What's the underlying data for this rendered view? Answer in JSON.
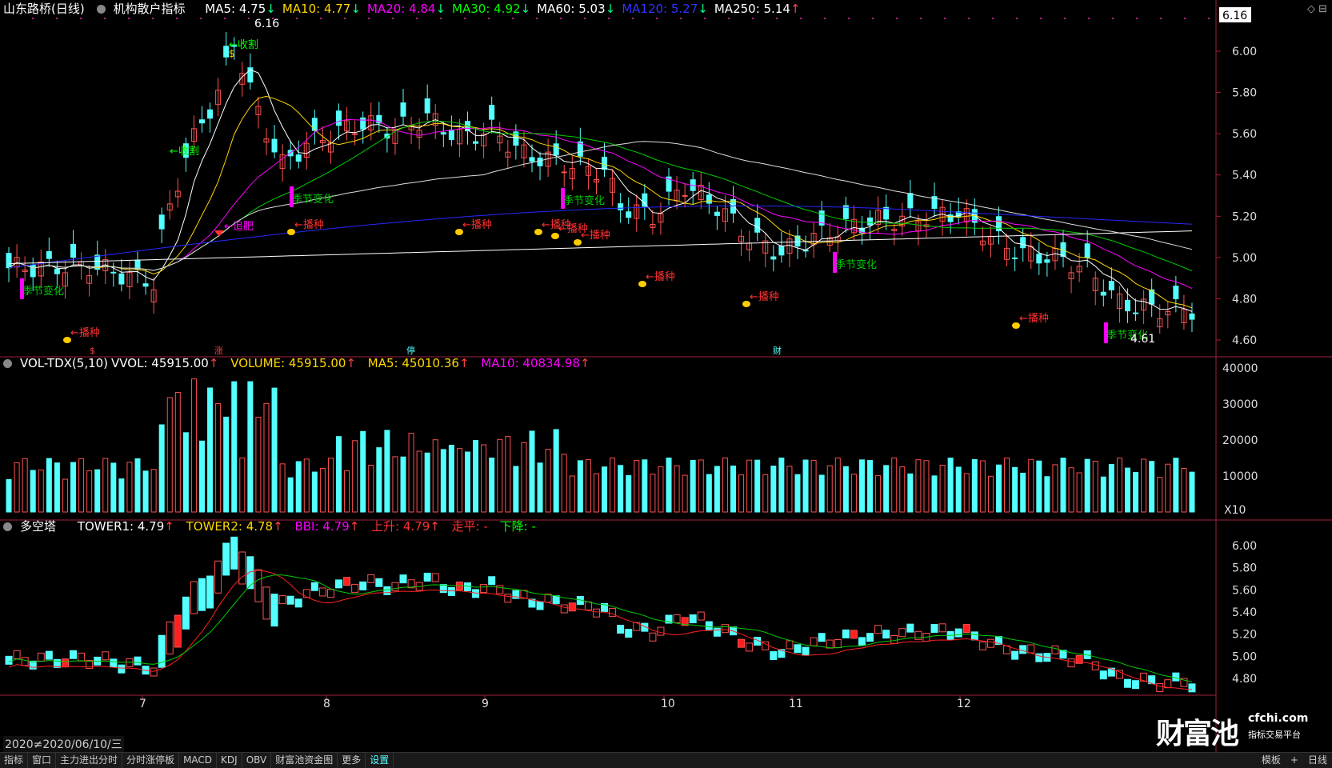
{
  "main": {
    "stock_name": "山东路桥(日线)",
    "indicator": "机构散户指标",
    "ma": [
      {
        "label": "MA5: 4.75",
        "color": "#ffffff"
      },
      {
        "label": "MA10: 4.77",
        "color": "#ffd700"
      },
      {
        "label": "MA20: 4.84",
        "color": "#ff00ff"
      },
      {
        "label": "MA30: 4.92",
        "color": "#00ff00"
      },
      {
        "label": "MA60: 5.03",
        "color": "#ffffff"
      },
      {
        "label": "MA120: 5.27",
        "color": "#3333ff"
      },
      {
        "label": "MA250: 5.14",
        "color": "#ffffff"
      }
    ],
    "arrow_down": "↓",
    "arrow_up": "↑",
    "y_ticks": [
      "6.00",
      "5.80",
      "5.60",
      "5.40",
      "5.20",
      "5.00",
      "4.80",
      "4.60"
    ],
    "high_tag": "6.16",
    "high_label": "6.16",
    "low_label": "4.61",
    "annotations": {
      "harvest": "收割",
      "sow": "播种",
      "season": "季节变化",
      "chase": "追肥"
    },
    "markers": [
      "$",
      "涨",
      "停",
      "财"
    ]
  },
  "volume": {
    "title": "VOL-TDX(5,10)",
    "vvol": "VVOL: 45915.00",
    "volume": "VOLUME: 45915.00",
    "ma5": "MA5: 45010.36",
    "ma10": "MA10: 40834.98",
    "y_ticks": [
      "40000",
      "30000",
      "20000",
      "10000"
    ],
    "unit": "X10"
  },
  "tower": {
    "title": "多空塔",
    "tower1": "TOWER1: 4.79",
    "tower2": "TOWER2: 4.78",
    "bbi": "BBI: 4.79",
    "up": "上升: 4.79",
    "flat": "走平: -",
    "down": "下降: -",
    "y_ticks": [
      "6.00",
      "5.80",
      "5.60",
      "5.40",
      "5.20",
      "5.00",
      "4.80"
    ]
  },
  "x_axis": {
    "date_label": "2020≠2020/06/10/三",
    "months": [
      "7",
      "8",
      "9",
      "10",
      "11",
      "12"
    ]
  },
  "bottom_tabs": [
    "指标",
    "窗口",
    "主力进出分时",
    "分时涨停板",
    "MACD",
    "KDJ",
    "OBV",
    "财富池资金图",
    "更多",
    "设置"
  ],
  "bottom_right": [
    "模板",
    "+",
    "日线"
  ],
  "watermark": {
    "big": "财富池",
    "url": "cfchi.com",
    "sub": "指标交易平台"
  },
  "top_right_icons": [
    "◇",
    "⊟"
  ],
  "colors": {
    "up": "#ff5050",
    "down": "#54ffff",
    "bg": "#000000",
    "grid": "#aa2255"
  }
}
